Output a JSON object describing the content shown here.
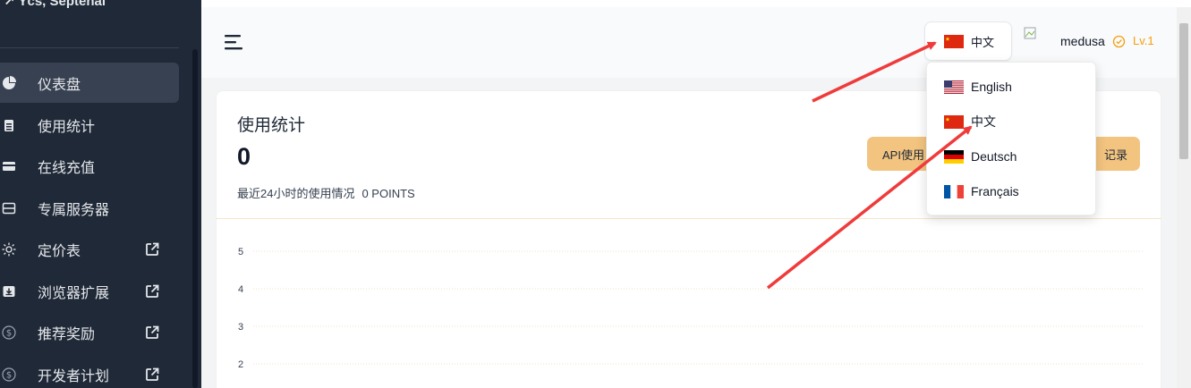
{
  "sidebar": {
    "brand": "Ycs, Septenal",
    "items": [
      {
        "label": "仪表盘",
        "icon": "pie-chart-icon",
        "external": false,
        "active": true
      },
      {
        "label": "使用统计",
        "icon": "clipboard-icon",
        "external": false
      },
      {
        "label": "在线充值",
        "icon": "credit-card-icon",
        "external": false
      },
      {
        "label": "专属服务器",
        "icon": "server-icon",
        "external": false
      },
      {
        "label": "定价表",
        "icon": "sun-icon",
        "external": true
      },
      {
        "label": "浏览器扩展",
        "icon": "download-box-icon",
        "external": true
      },
      {
        "label": "推荐奖励",
        "icon": "dollar-circle-icon",
        "external": true
      },
      {
        "label": "开发者计划",
        "icon": "dollar-circle-icon",
        "external": true
      }
    ]
  },
  "header": {
    "language": "中文",
    "avatar_alt": "avatar",
    "username": "medusa",
    "level": "Lv.1"
  },
  "language_menu": {
    "options": [
      "English",
      "中文",
      "Deutsch",
      "Français"
    ]
  },
  "card": {
    "title": "使用统计",
    "value": "0",
    "subtitle": "最近24小时的使用情况",
    "points": "0 POINTS",
    "api_button": "API使用",
    "records_button": "记录"
  },
  "chart_data": {
    "type": "line",
    "y_ticks": [
      "5",
      "4",
      "3",
      "2"
    ],
    "ylim": [
      0,
      5
    ],
    "series": [],
    "grid": "dotted horizontal"
  },
  "colors": {
    "sidebar_bg": "#1f2937",
    "accent_button": "#f2c47f",
    "level": "#f59e0b",
    "arrow": "#ef3b3b"
  }
}
